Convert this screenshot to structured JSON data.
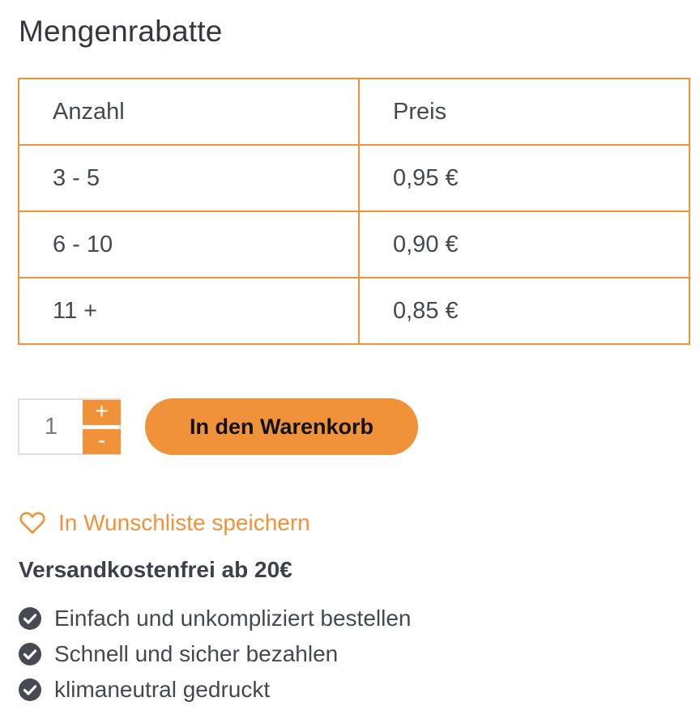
{
  "section": {
    "title": "Mengenrabatte"
  },
  "table": {
    "headers": [
      "Anzahl",
      "Preis"
    ],
    "rows": [
      [
        "3 - 5",
        "0,95 €"
      ],
      [
        "6 - 10",
        "0,90 €"
      ],
      [
        "11 +",
        "0,85 €"
      ]
    ]
  },
  "quantity": {
    "value": "1",
    "increment_label": "+",
    "decrement_label": "-"
  },
  "cart": {
    "button_label": "In den Warenkorb"
  },
  "wishlist": {
    "icon": "heart-outline-icon",
    "label": "In Wunschliste speichern"
  },
  "shipping": {
    "text": "Versandkostenfrei ab 20€"
  },
  "features": {
    "icon": "check-circle-icon",
    "items": [
      "Einfach und unkompliziert bestellen",
      "Schnell und sicher bezahlen",
      "klimaneutral gedruckt"
    ]
  },
  "colors": {
    "accent": "#f0923a",
    "text": "#444852",
    "check": "#474a52"
  }
}
